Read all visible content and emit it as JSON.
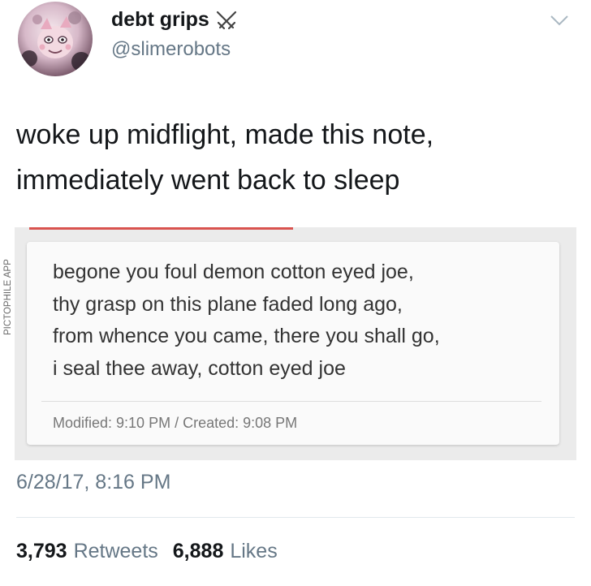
{
  "tweet": {
    "author": {
      "display_name": "debt grips",
      "handle": "@slimerobots",
      "badge_icon": "crossed-swords-icon",
      "avatar_icon": "avatar-image"
    },
    "menu_icon": "chevron-down-icon",
    "text_lines": [
      "woke up midflight, made this note,",
      "immediately went back to sleep"
    ],
    "photo": {
      "watermark": "PICTOPHILE APP",
      "note_lines": [
        "begone you foul demon cotton eyed joe,",
        "thy grasp on this plane faded long ago,",
        "from whence you came, there you shall go,",
        "i seal thee away, cotton eyed joe"
      ],
      "meta": "Modified: 9:10 PM / Created: 9:08 PM",
      "accent_color": "#d9534f"
    },
    "timestamp": "6/28/17, 8:16 PM",
    "stats": {
      "retweets_count": "3,793",
      "retweets_label": "Retweets",
      "likes_count": "6,888",
      "likes_label": "Likes"
    }
  },
  "colors": {
    "text_primary": "#14171a",
    "text_secondary": "#657786",
    "divider": "#e1e8ed"
  }
}
